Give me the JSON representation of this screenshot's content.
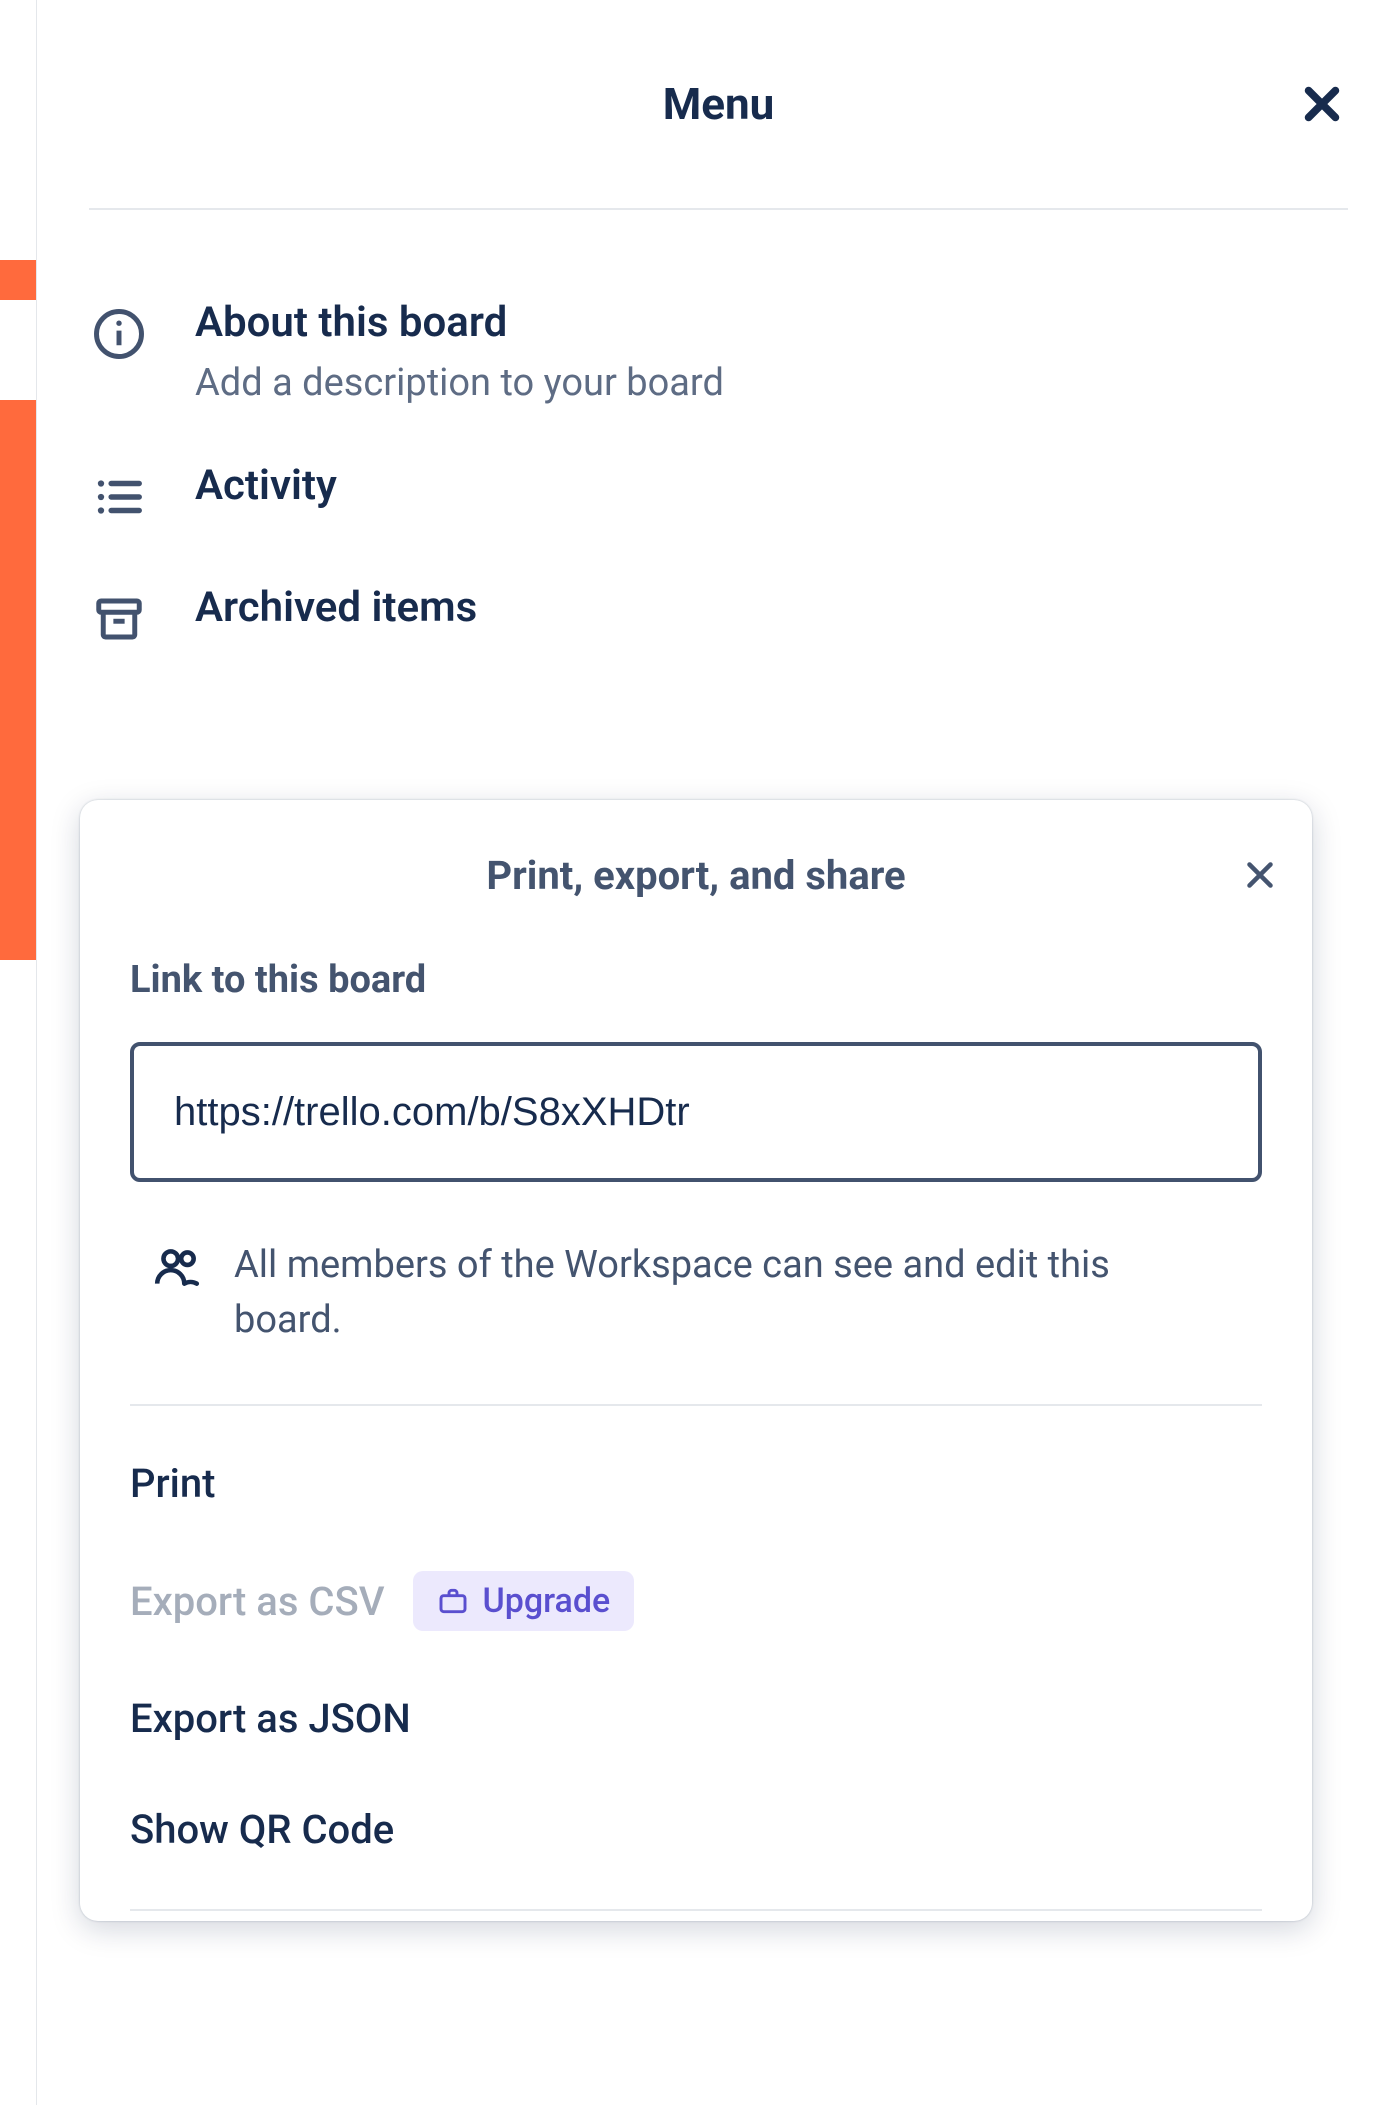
{
  "panel": {
    "title": "Menu",
    "items": [
      {
        "label": "About this board",
        "sub": "Add a description to your board"
      },
      {
        "label": "Activity"
      },
      {
        "label": "Archived items"
      }
    ]
  },
  "popover": {
    "title": "Print, export, and share",
    "link_section_label": "Link to this board",
    "link_value": "https://trello.com/b/S8xXHDtr",
    "visibility_text": "All members of the Workspace can see and edit this board.",
    "actions": {
      "print": "Print",
      "export_csv": "Export as CSV",
      "export_json": "Export as JSON",
      "show_qr": "Show QR Code"
    },
    "upgrade_badge": "Upgrade"
  }
}
